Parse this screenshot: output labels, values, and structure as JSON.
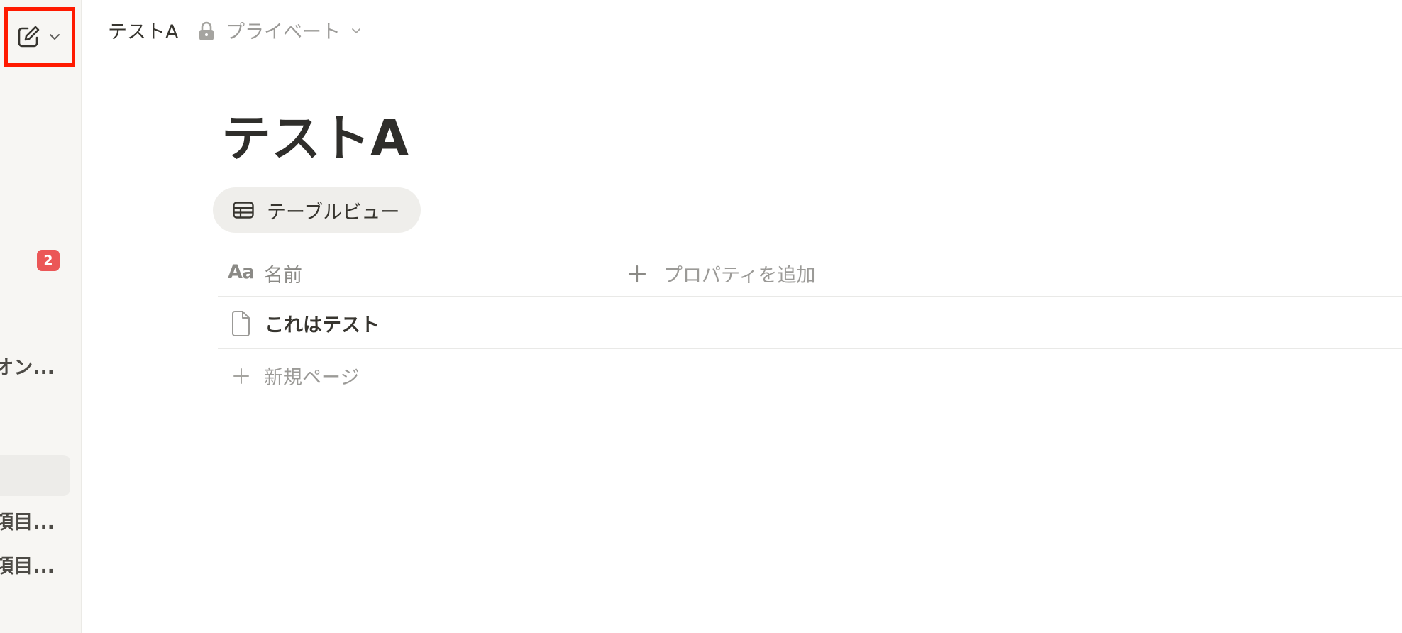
{
  "sidebar": {
    "new_page_icon": "edit-square-icon",
    "new_page_chevron_icon": "chevron-down-icon",
    "inbox_badge": "2",
    "items": [
      {
        "label": "オン..."
      },
      {
        "label": "項目..."
      },
      {
        "label": "項目..."
      }
    ]
  },
  "topbar": {
    "breadcrumb_title": "テストA",
    "privacy_icon": "lock-icon",
    "privacy_label": "プライベート"
  },
  "page": {
    "title": "テストA",
    "view_tab": {
      "icon": "table-icon",
      "label": "テーブルビュー"
    },
    "table": {
      "columns": [
        {
          "icon": "text-aa-icon",
          "icon_text": "Aa",
          "label": "名前"
        }
      ],
      "add_property_label": "プロパティを追加",
      "rows": [
        {
          "icon": "document-icon",
          "title": "これはテスト"
        }
      ],
      "new_row_label": "新規ページ"
    }
  },
  "colors": {
    "sidebar_bg": "#f7f6f3",
    "highlight_box": "#ff1a00",
    "badge": "#eb5757",
    "muted_text": "#9b9a97"
  }
}
